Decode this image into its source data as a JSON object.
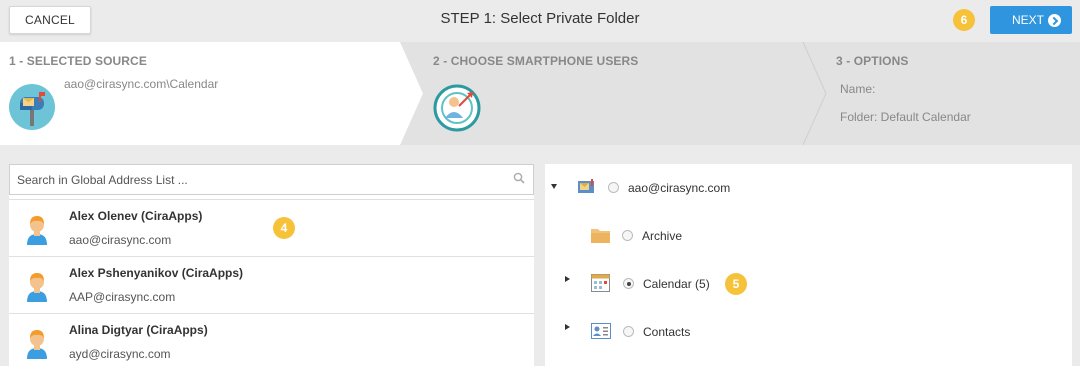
{
  "header": {
    "cancel_label": "CANCEL",
    "title": "STEP 1: Select Private Folder",
    "next_label": "NEXT",
    "badge_next": "6"
  },
  "steps": [
    {
      "title": "1 - SELECTED SOURCE",
      "text": "aao@cirasync.com\\Calendar"
    },
    {
      "title": "2 - CHOOSE SMARTPHONE USERS"
    },
    {
      "title": "3 - OPTIONS",
      "name_label": "Name:",
      "folder_label": "Folder: Default Calendar"
    }
  ],
  "search": {
    "placeholder": "Search in Global Address List ..."
  },
  "users": [
    {
      "name": "Alex Olenev (CiraApps)",
      "email": "aao@cirasync.com",
      "badge": "4"
    },
    {
      "name": "Alex Pshenyanikov (CiraApps)",
      "email": "AAP@cirasync.com"
    },
    {
      "name": "Alina Digtyar (CiraApps)",
      "email": "ayd@cirasync.com"
    }
  ],
  "tree": {
    "root": "aao@cirasync.com",
    "items": [
      {
        "label": "Archive",
        "icon": "folder-icon",
        "selected": false
      },
      {
        "label": "Calendar (5)",
        "icon": "calendar-icon",
        "selected": true,
        "badge": "5"
      },
      {
        "label": "Contacts",
        "icon": "contacts-icon",
        "selected": false
      }
    ]
  },
  "colors": {
    "accent": "#2e95de",
    "badge": "#f6c23a",
    "background": "#ebebeb"
  }
}
